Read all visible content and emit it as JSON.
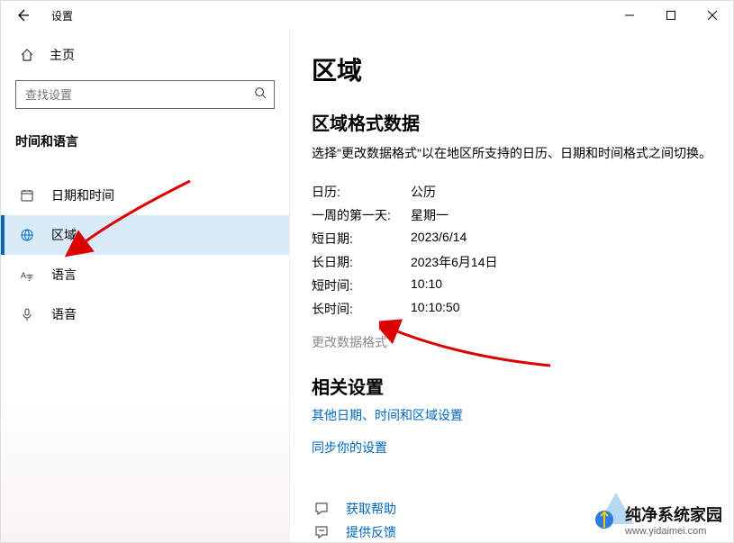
{
  "app": {
    "title": "设置"
  },
  "sidebar": {
    "home": "主页",
    "search_placeholder": "查找设置",
    "category": "时间和语言",
    "items": [
      {
        "label": "日期和时间"
      },
      {
        "label": "区域"
      },
      {
        "label": "语言"
      },
      {
        "label": "语音"
      }
    ]
  },
  "main": {
    "title": "区域",
    "section_title": "区域格式数据",
    "section_desc": "选择\"更改数据格式\"以在地区所支持的日历、日期和时间格式之间切换。",
    "rows": {
      "calendar_k": "日历:",
      "calendar_v": "公历",
      "firstday_k": "一周的第一天:",
      "firstday_v": "星期一",
      "shortdate_k": "短日期:",
      "shortdate_v": "2023/6/14",
      "longdate_k": "长日期:",
      "longdate_v": "2023年6月14日",
      "shorttime_k": "短时间:",
      "shorttime_v": "10:10",
      "longtime_k": "长时间:",
      "longtime_v": "10:10:50"
    },
    "change_format": "更改数据格式",
    "related_title": "相关设置",
    "related_link1": "其他日期、时间和区域设置",
    "related_link2": "同步你的设置",
    "help": "获取帮助",
    "feedback": "提供反馈"
  },
  "watermark": {
    "main": "纯净系统家园",
    "sub": "www.yidaimei.com"
  }
}
